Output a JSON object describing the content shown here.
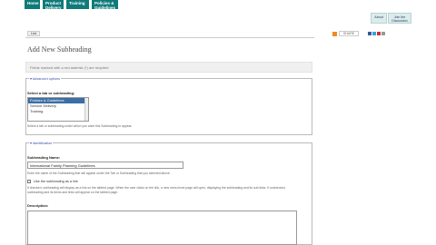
{
  "topnav": {
    "tabs": [
      "Home",
      "Product Delivery",
      "Training",
      "Policies & Guidelines"
    ]
  },
  "header": {
    "about_label": "About",
    "join_label": "Join the Discussion"
  },
  "share": {
    "share_label": "SHARE",
    "social_label": "♦ 8i ♦ ■"
  },
  "toolbar": {
    "list_label": "List"
  },
  "page": {
    "title": "Add New Subheading",
    "required_notice": "Fields marked with a red asterisk (*) are required"
  },
  "advanced": {
    "legend": "Advanced options",
    "select_label": "Select a tab or subheading:",
    "options": [
      "Policies & Guidelines",
      "Service Delivery",
      "Training"
    ],
    "selected": "Policies & Guidelines",
    "help": "Select a tab or subheading under which you want this Subheading to appear."
  },
  "identification": {
    "legend": "Identification",
    "name_label": "Subheading Name:",
    "name_value": "International Family Planning Guidelines",
    "name_help": "Enter the name of the Subheading that will appear under the Tab or Subheading that you selected above.",
    "checkbox_label": "Use the subheading as a link",
    "checkbox_help": "If checked, subheading will display as a link on the tabbed page. When the user clicks on the link, a new menu level page will open, displaying the subheading and its sub-links. If unchecked, subheading and its items and links will appear on the tabbed page.",
    "description_label": "Description:"
  }
}
